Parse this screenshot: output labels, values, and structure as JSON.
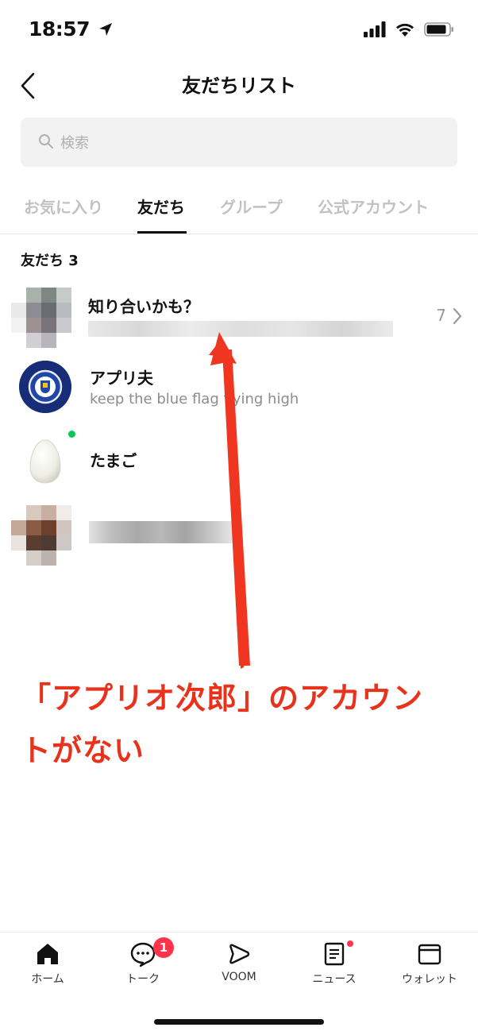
{
  "status_bar": {
    "time": "18:57"
  },
  "header": {
    "title": "友だちリスト"
  },
  "search": {
    "placeholder": "検索"
  },
  "tabs": [
    {
      "label": "お気に入り",
      "active": false
    },
    {
      "label": "友だち",
      "active": true
    },
    {
      "label": "グループ",
      "active": false
    },
    {
      "label": "公式アカウント",
      "active": false
    }
  ],
  "section": {
    "label": "友だち 3"
  },
  "rows": [
    {
      "title": "知り合いかも？",
      "count": "7"
    },
    {
      "title": "アプリ夫",
      "subtitle": "keep the blue flag flying high"
    },
    {
      "title": "たまご"
    }
  ],
  "annotation": {
    "line1": "「アプリオ次郎」のアカウン",
    "line2": "トがない"
  },
  "bottom_nav": [
    {
      "label": "ホーム",
      "icon": "home-icon"
    },
    {
      "label": "トーク",
      "icon": "chat-icon",
      "badge": "1"
    },
    {
      "label": "VOOM",
      "icon": "voom-icon"
    },
    {
      "label": "ニュース",
      "icon": "news-icon"
    },
    {
      "label": "ウォレット",
      "icon": "wallet-icon"
    }
  ],
  "colors": {
    "annotation_red": "#e8321c",
    "badge_red": "#ff334b",
    "online_green": "#06c755",
    "chelsea_blue": "#1f3a93"
  }
}
